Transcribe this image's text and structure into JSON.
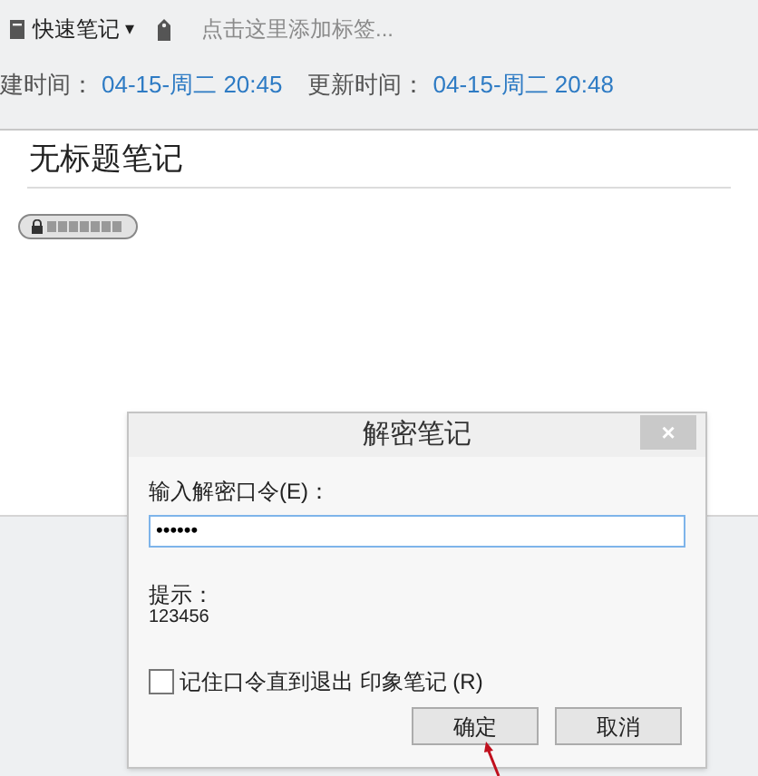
{
  "toolbar": {
    "notebook": "快速笔记",
    "notebook_caret": "▾",
    "tag_placeholder": "点击这里添加标签..."
  },
  "meta": {
    "created_label": "建时间：",
    "created": "04-15-周二 20:45",
    "updated_label": "更新时间：",
    "updated": "04-15-周二 20:48"
  },
  "note": {
    "title": "无标题笔记"
  },
  "dialog": {
    "title": "解密笔记",
    "close": "×",
    "password_label": "输入解密口令(E)：",
    "password_value": "••••••",
    "hint_label": "提示：",
    "hint": "123456",
    "remember": {
      "label": "记住口令直到退出 印象笔记 (R)",
      "checked": false
    },
    "buttons": [
      "确定",
      "取消"
    ]
  }
}
